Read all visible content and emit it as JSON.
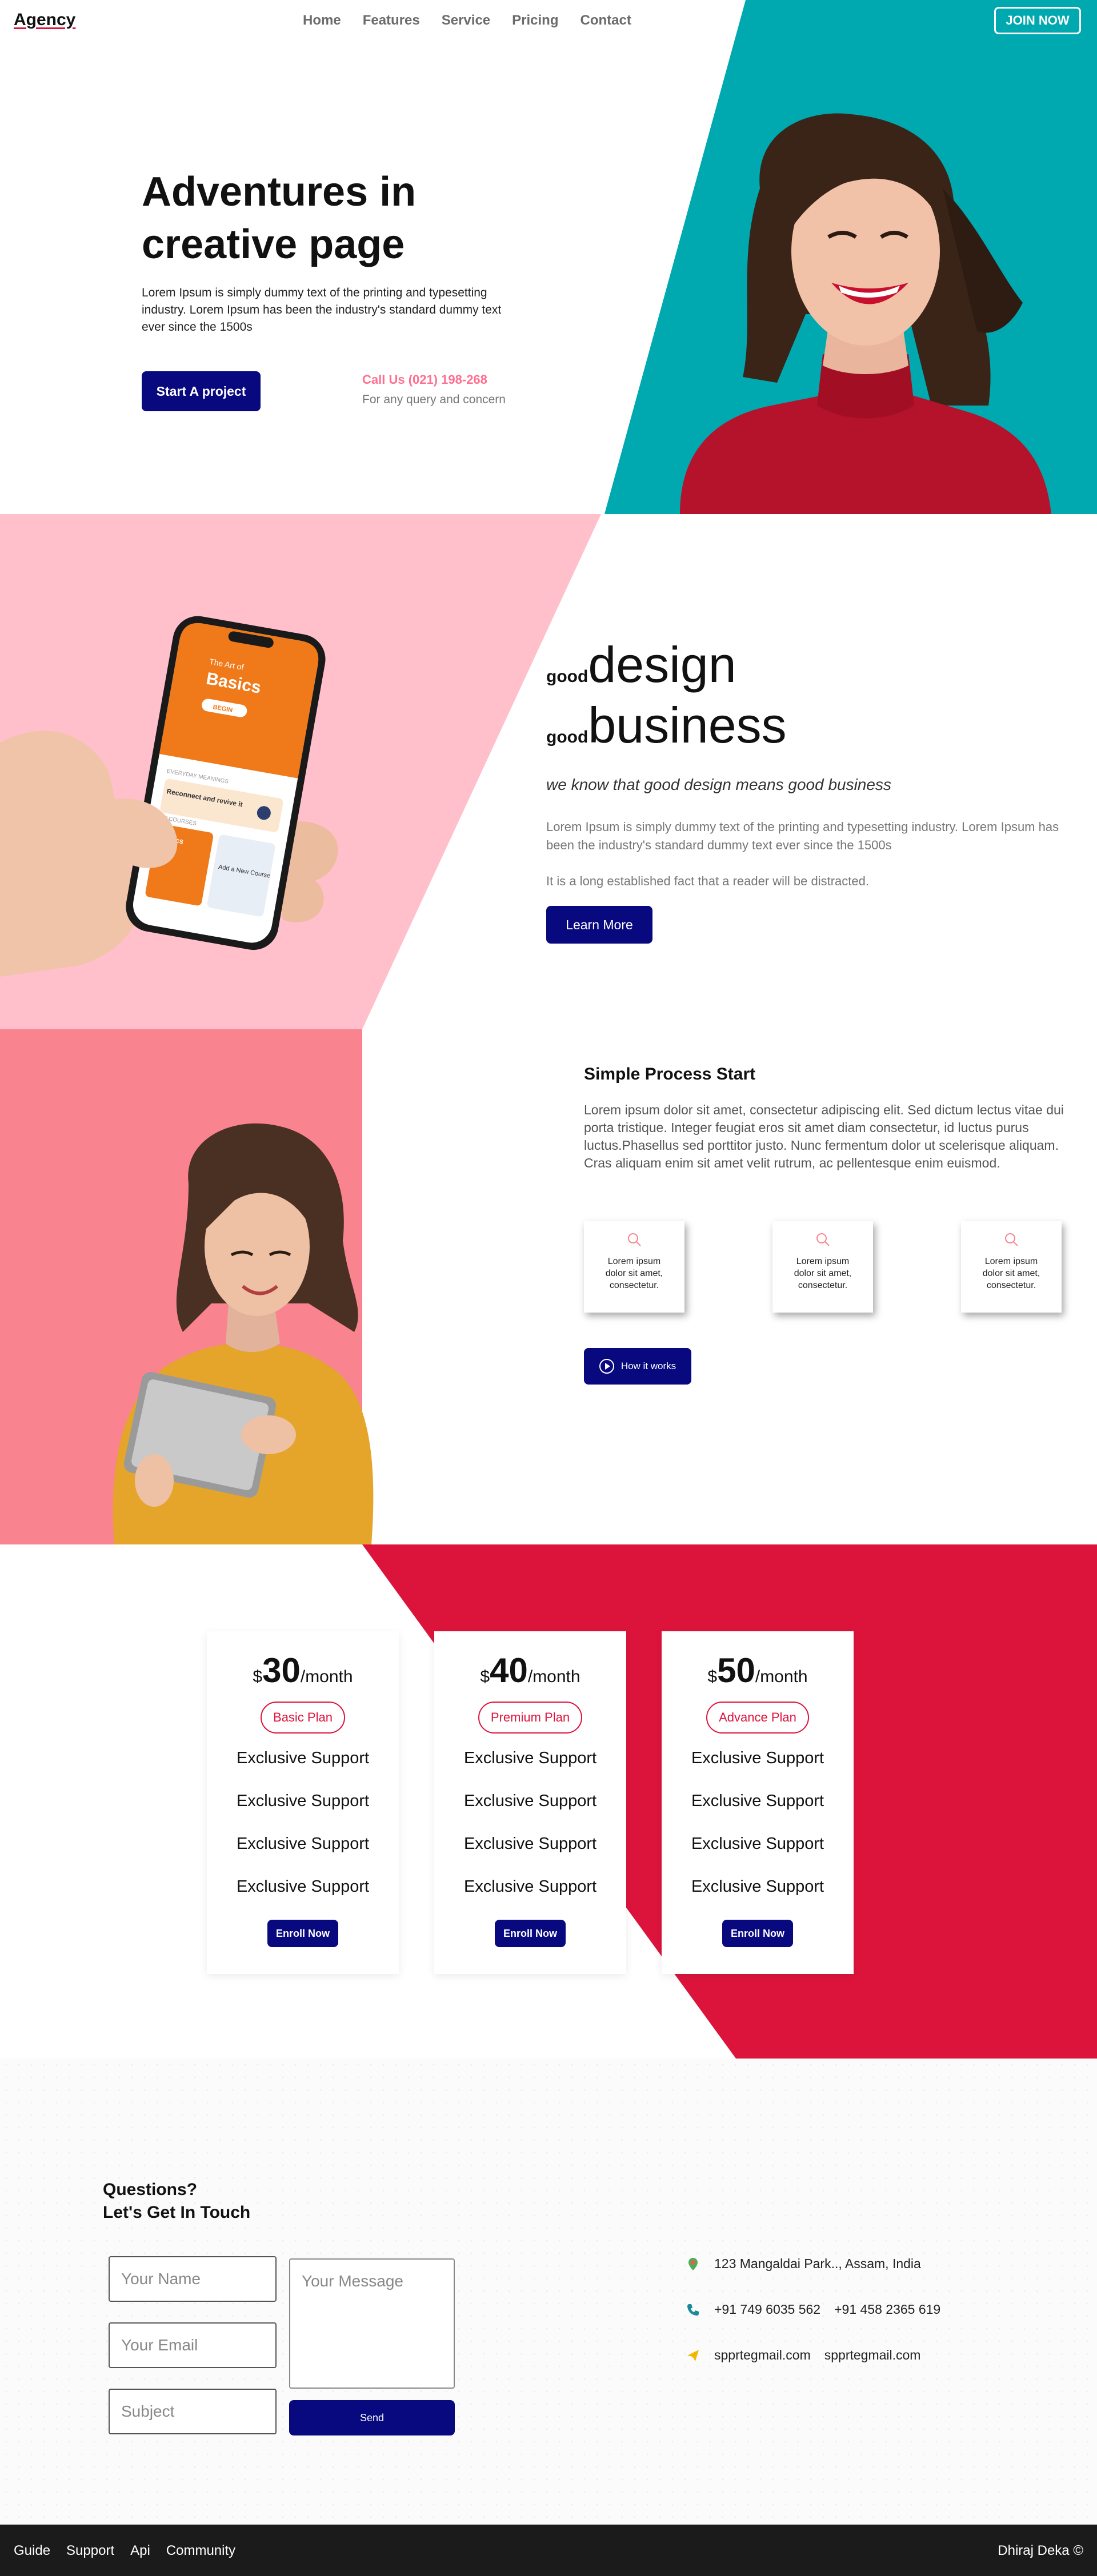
{
  "colors": {
    "teal": "#00a8b0",
    "pink_light": "#ffc0cb",
    "coral": "#f9838f",
    "crimson": "#dc143c",
    "navy": "#08087f",
    "call_pink": "#ff6f8f",
    "footer": "#1b1b1b"
  },
  "nav": {
    "logo": "Agency",
    "links": [
      "Home",
      "Features",
      "Service",
      "Pricing",
      "Contact"
    ],
    "join": "JOIN NOW"
  },
  "hero": {
    "title_line1": "Adventures in",
    "title_line2": "creative page",
    "description": "Lorem Ipsum is simply dummy text of the printing and typesetting industry. Lorem Ipsum has been the industry's standard dummy text ever since the 1500s",
    "cta": "Start A project",
    "call": "Call Us (021) 198-268",
    "call_sub": "For any query and concern"
  },
  "design": {
    "small1": "good",
    "big1": "design",
    "small2": "good",
    "big2": "business",
    "tagline": "we know that good design means good business",
    "description": "Lorem Ipsum is simply dummy text of the printing and typesetting industry. Lorem Ipsum has been the industry's standard dummy text ever since the 1500s",
    "description2": "It is a long established fact that a reader will be distracted.",
    "cta": "Learn More",
    "phone_screen": {
      "top_text": "The Art of",
      "title": "Basics",
      "button": "BEGIN",
      "section": "EVERYDAY MEANINGS",
      "card_text": "Reconnect and revive it",
      "section2": "MY COURSES",
      "course1": "Basics",
      "course2": "Add a New Course"
    }
  },
  "process": {
    "title": "Simple Process Start",
    "description": "Lorem ipsum dolor sit amet, consectetur adipiscing elit. Sed dictum lectus vitae dui porta tristique. Integer feugiat eros sit amet diam consectetur, id luctus purus luctus.Phasellus sed porttitor justo. Nunc fermentum dolor ut scelerisque aliquam. Cras aliquam enim sit amet velit rutrum, ac pellentesque enim euismod.",
    "cards": [
      {
        "text": "Lorem ipsum dolor sit amet, consectetur.",
        "icon": "search-icon"
      },
      {
        "text": "Lorem ipsum dolor sit amet, consectetur.",
        "icon": "search-icon"
      },
      {
        "text": "Lorem ipsum dolor sit amet, consectetur.",
        "icon": "search-icon"
      }
    ],
    "cta": "How it works"
  },
  "pricing": {
    "plans": [
      {
        "currency": "$",
        "amount": "30",
        "period": "/month",
        "name": "Basic Plan",
        "features": [
          "Exclusive Support",
          "Exclusive Support",
          "Exclusive Support",
          "Exclusive Support"
        ],
        "cta": "Enroll Now"
      },
      {
        "currency": "$",
        "amount": "40",
        "period": "/month",
        "name": "Premium Plan",
        "features": [
          "Exclusive Support",
          "Exclusive Support",
          "Exclusive Support",
          "Exclusive Support"
        ],
        "cta": "Enroll Now"
      },
      {
        "currency": "$",
        "amount": "50",
        "period": "/month",
        "name": "Advance Plan",
        "features": [
          "Exclusive Support",
          "Exclusive Support",
          "Exclusive Support",
          "Exclusive Support"
        ],
        "cta": "Enroll Now"
      }
    ]
  },
  "contact": {
    "title_line1": "Questions?",
    "title_line2": "Let's Get In Touch",
    "name_placeholder": "Your Name",
    "email_placeholder": "Your Email",
    "subject_placeholder": "Subject",
    "message_placeholder": "Your Message",
    "send": "Send",
    "address": "123 Mangaldai Park.., Assam, India",
    "phone1": "+91 749 6035 562",
    "phone2": "+91 458 2365 619",
    "email1": "spprtegmail.com",
    "email2": "spprtegmail.com"
  },
  "footer": {
    "links": [
      "Guide",
      "Support",
      "Api",
      "Community"
    ],
    "credit": "Dhiraj Deka ©"
  }
}
